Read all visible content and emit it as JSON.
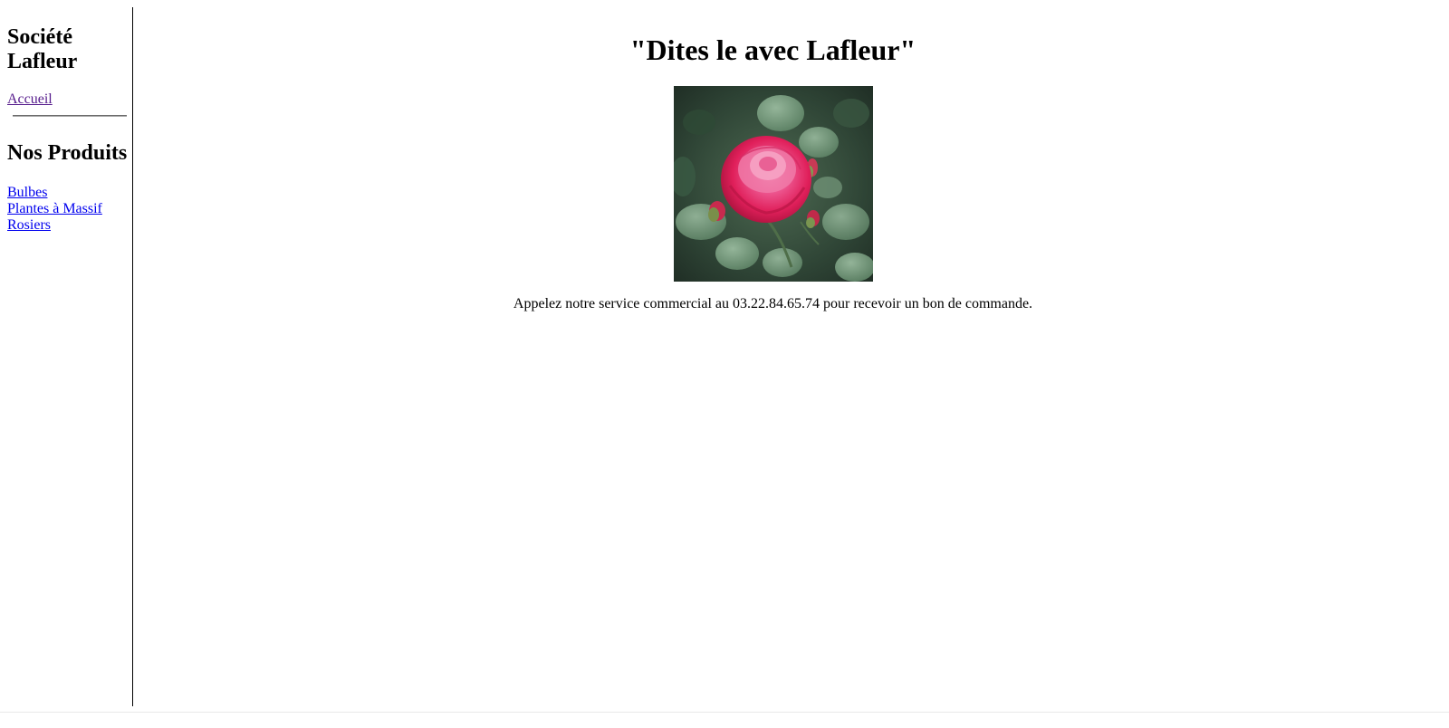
{
  "sidebar": {
    "title": "Société Lafleur",
    "home_link": "Accueil",
    "products_heading": "Nos Produits",
    "products": [
      {
        "label": "Bulbes"
      },
      {
        "label": "Plantes à Massif"
      },
      {
        "label": "Rosiers"
      }
    ]
  },
  "main": {
    "slogan": "\"Dites le avec Lafleur\"",
    "image_subject": "pink-rose-photo",
    "contact_text": "Appelez notre service commercial au 03.22.84.65.74 pour recevoir un bon de commande."
  },
  "colors": {
    "visited_link": "#551a8b",
    "link": "#0000ee",
    "text": "#000000",
    "background": "#ffffff"
  }
}
